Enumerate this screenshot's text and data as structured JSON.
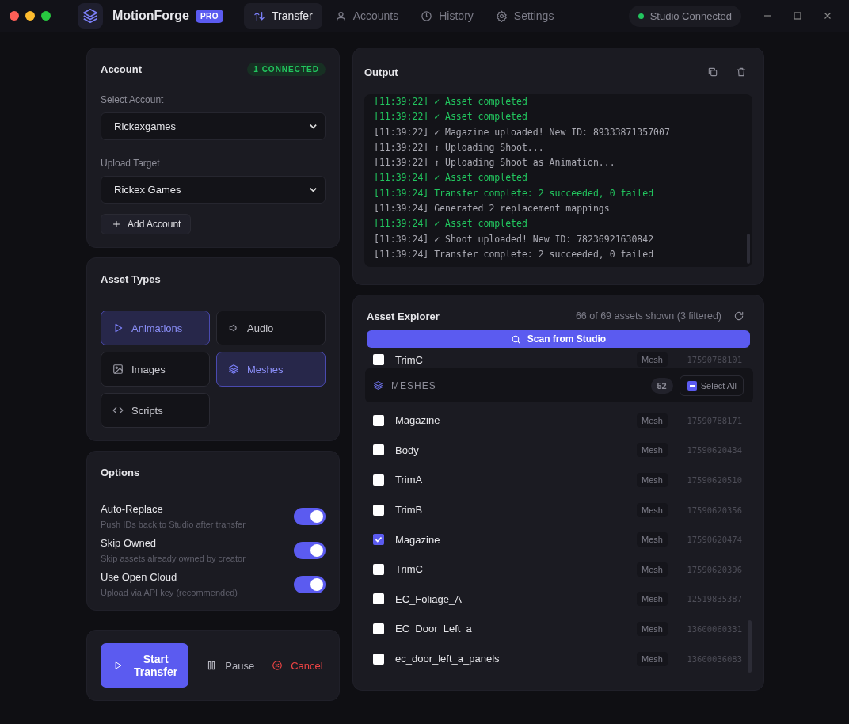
{
  "titlebar": {
    "app_name": "MotionForge",
    "badge": "PRO",
    "nav": [
      {
        "label": "Transfer",
        "kind": "transfer",
        "selected": true
      },
      {
        "label": "Accounts",
        "kind": "user",
        "selected": false
      },
      {
        "label": "History",
        "kind": "clock",
        "selected": false
      },
      {
        "label": "Settings",
        "kind": "gear",
        "selected": false
      }
    ],
    "status": {
      "label": "Studio Connected",
      "connected": true
    }
  },
  "account": {
    "title": "Account",
    "badge": "1 CONNECTED",
    "fields": [
      {
        "label": "Select Account",
        "value": "Rickexgames"
      },
      {
        "label": "Upload Target",
        "value": "Rickex Games"
      }
    ],
    "add_button": "Add Account"
  },
  "asset_types": {
    "title": "Asset Types",
    "items": [
      {
        "label": "Animations",
        "kind": "play",
        "selected": true
      },
      {
        "label": "Audio",
        "kind": "speaker",
        "selected": false
      },
      {
        "label": "Images",
        "kind": "image",
        "selected": false
      },
      {
        "label": "Meshes",
        "kind": "layers",
        "selected": true
      },
      {
        "label": "Scripts",
        "kind": "code",
        "selected": false
      }
    ]
  },
  "options": {
    "title": "Options",
    "items": [
      {
        "label": "Auto-Replace",
        "hint": "Push IDs back to Studio after transfer",
        "on": true
      },
      {
        "label": "Skip Owned",
        "hint": "Skip assets already owned by creator",
        "on": true
      },
      {
        "label": "Use Open Cloud",
        "hint": "Upload via API key (recommended)",
        "on": true
      }
    ]
  },
  "actions": {
    "start": "Start Transfer",
    "pause": "Pause",
    "cancel": "Cancel"
  },
  "output": {
    "title": "Output",
    "lines": [
      {
        "kind": "success",
        "text": "[11:39:22] ✓ Asset completed"
      },
      {
        "kind": "success",
        "text": "[11:39:22] ✓ Asset completed"
      },
      {
        "kind": "info",
        "text": "[11:39:22] ✓ Magazine uploaded! New ID: 89333871357007"
      },
      {
        "kind": "info",
        "text": "[11:39:22] ↑ Uploading Shoot..."
      },
      {
        "kind": "info",
        "text": "[11:39:22] ↑ Uploading Shoot as Animation..."
      },
      {
        "kind": "success",
        "text": "[11:39:24] ✓ Asset completed"
      },
      {
        "kind": "success",
        "text": "[11:39:24] Transfer complete: 2 succeeded, 0 failed"
      },
      {
        "kind": "info",
        "text": "[11:39:24] Generated 2 replacement mappings"
      },
      {
        "kind": "success",
        "text": "[11:39:24] ✓ Asset completed"
      },
      {
        "kind": "info",
        "text": "[11:39:24] ✓ Shoot uploaded! New ID: 78236921630842"
      },
      {
        "kind": "info",
        "text": "[11:39:24] Transfer complete: 2 succeeded, 0 failed"
      }
    ]
  },
  "explorer": {
    "title": "Asset Explorer",
    "summary": "66 of 69 assets shown (3 filtered)",
    "scan_button": "Scan from Studio",
    "rows_above": [
      {
        "name": "TrimC",
        "type": "Mesh",
        "id": "17590788101",
        "checked": false
      }
    ],
    "group": {
      "label": "MESHES",
      "count": "52",
      "select_all": "Select All"
    },
    "rows": [
      {
        "name": "Magazine",
        "type": "Mesh",
        "id": "17590788171",
        "checked": false
      },
      {
        "name": "Body",
        "type": "Mesh",
        "id": "17590620434",
        "checked": false
      },
      {
        "name": "TrimA",
        "type": "Mesh",
        "id": "17590620510",
        "checked": false
      },
      {
        "name": "TrimB",
        "type": "Mesh",
        "id": "17590620356",
        "checked": false
      },
      {
        "name": "Magazine",
        "type": "Mesh",
        "id": "17590620474",
        "checked": true
      },
      {
        "name": "TrimC",
        "type": "Mesh",
        "id": "17590620396",
        "checked": false
      },
      {
        "name": "EC_Foliage_A",
        "type": "Mesh",
        "id": "12519835387",
        "checked": false
      },
      {
        "name": "EC_Door_Left_a",
        "type": "Mesh",
        "id": "13600060331",
        "checked": false
      },
      {
        "name": "ec_door_left_a_panels",
        "type": "Mesh",
        "id": "13600036083",
        "checked": false
      }
    ]
  }
}
